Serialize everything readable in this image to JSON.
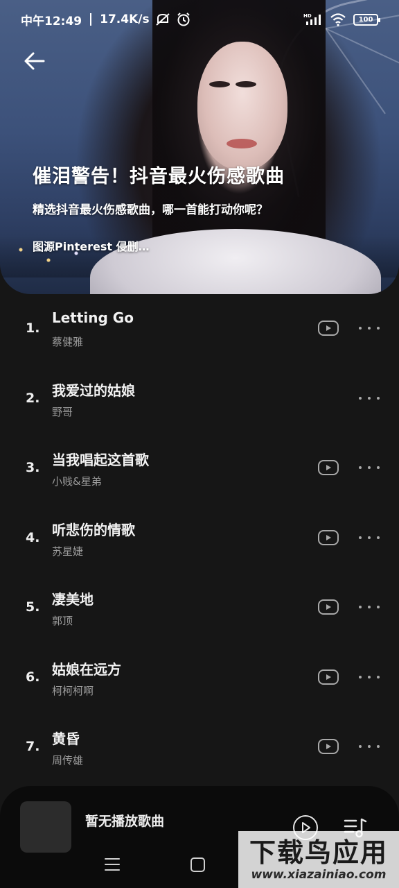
{
  "status_bar": {
    "time": "中午12:49",
    "net_speed": "17.4K/s",
    "hd_label": "HD",
    "battery": "100"
  },
  "header": {
    "title": "催泪警告！抖音最火伤感歌曲",
    "subtitle": "精选抖音最火伤感歌曲，哪一首能打动你呢？",
    "credit": "图源Pinterest 侵删…"
  },
  "songs": [
    {
      "index": "1.",
      "title": "Letting Go",
      "artist": "蔡健雅",
      "has_mv": true
    },
    {
      "index": "2.",
      "title": "我爱过的姑娘",
      "artist": "野哥",
      "has_mv": false
    },
    {
      "index": "3.",
      "title": "当我唱起这首歌",
      "artist": "小贱&星弟",
      "has_mv": true
    },
    {
      "index": "4.",
      "title": "听悲伤的情歌",
      "artist": "苏星婕",
      "has_mv": true
    },
    {
      "index": "5.",
      "title": "凄美地",
      "artist": "郭顶",
      "has_mv": true
    },
    {
      "index": "6.",
      "title": "姑娘在远方",
      "artist": "柯柯柯啊",
      "has_mv": true
    },
    {
      "index": "7.",
      "title": "黄昏",
      "artist": "周传雄",
      "has_mv": true
    }
  ],
  "player": {
    "now_playing": "暂无播放歌曲"
  },
  "watermark": {
    "text_big": "下载鸟应用",
    "text_small": "www.xiazainiao.com"
  },
  "icons": {
    "back": "arrow-left-icon",
    "mv": "video-play-icon",
    "more": "more-dots-icon",
    "play": "play-icon",
    "queue": "playlist-music-icon"
  }
}
